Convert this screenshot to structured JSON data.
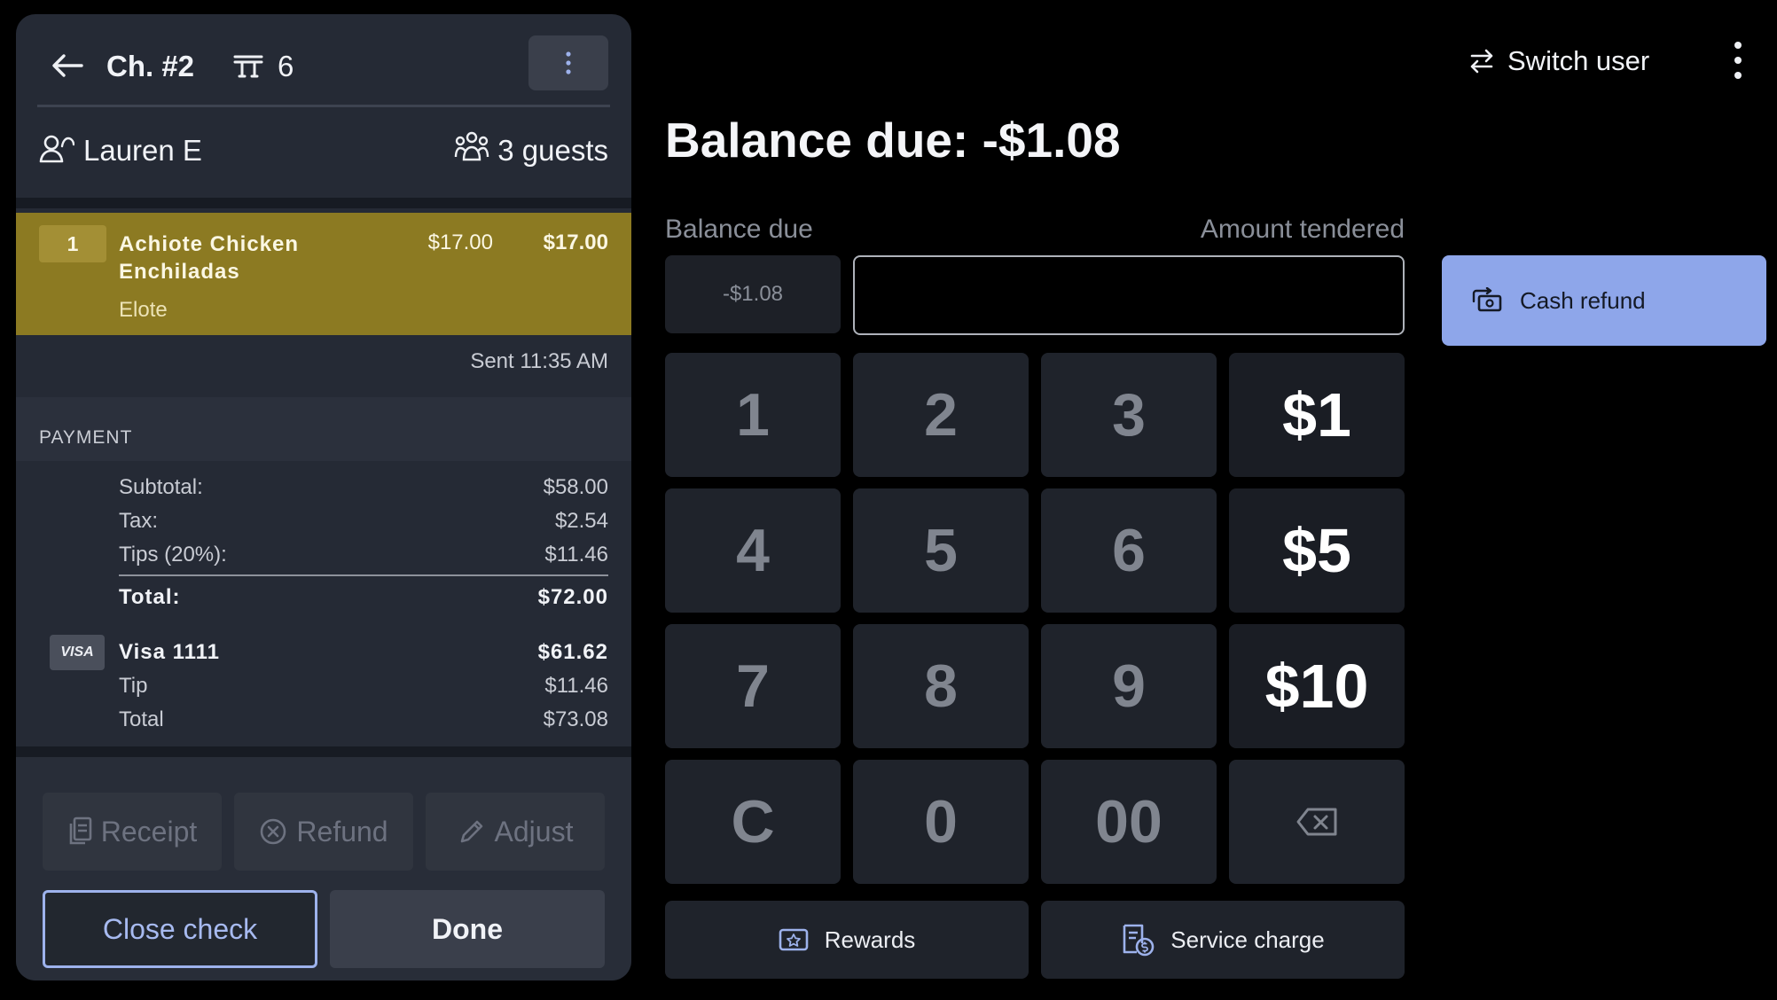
{
  "check": {
    "number": "Ch. #2",
    "table": "6",
    "server": "Lauren E",
    "guests": "3 guests"
  },
  "item": {
    "qty": "1",
    "name": "Achiote Chicken Enchiladas",
    "modifier": "Elote",
    "unit_price": "$17.00",
    "total": "$17.00",
    "highlight_color": "#8c7a22"
  },
  "sent": "Sent 11:35 AM",
  "payment": {
    "title": "PAYMENT",
    "subtotal_label": "Subtotal:",
    "subtotal": "$58.00",
    "tax_label": "Tax:",
    "tax": "$2.54",
    "tips_label": "Tips (20%):",
    "tips": "$11.46",
    "total_label": "Total:",
    "total": "$72.00",
    "card": {
      "brand": "VISA",
      "label": "Visa 1111",
      "amount": "$61.62",
      "tip_label": "Tip",
      "tip": "$11.46",
      "total_label": "Total",
      "total": "$73.08"
    }
  },
  "actions": {
    "receipt": "Receipt",
    "refund": "Refund",
    "adjust": "Adjust",
    "close_check": "Close check",
    "done": "Done"
  },
  "header": {
    "switch_user": "Switch user"
  },
  "tender": {
    "title": "Balance due: -$1.08",
    "balance_label": "Balance due",
    "balance_value": "-$1.08",
    "amount_label": "Amount tendered",
    "amount_value": "",
    "keys": [
      "1",
      "2",
      "3",
      "$1",
      "4",
      "5",
      "6",
      "$5",
      "7",
      "8",
      "9",
      "$10",
      "C",
      "0",
      "00"
    ],
    "rewards": "Rewards",
    "service_charge": "Service charge",
    "cash_refund": "Cash refund",
    "accent_color": "#8ea6ea"
  }
}
